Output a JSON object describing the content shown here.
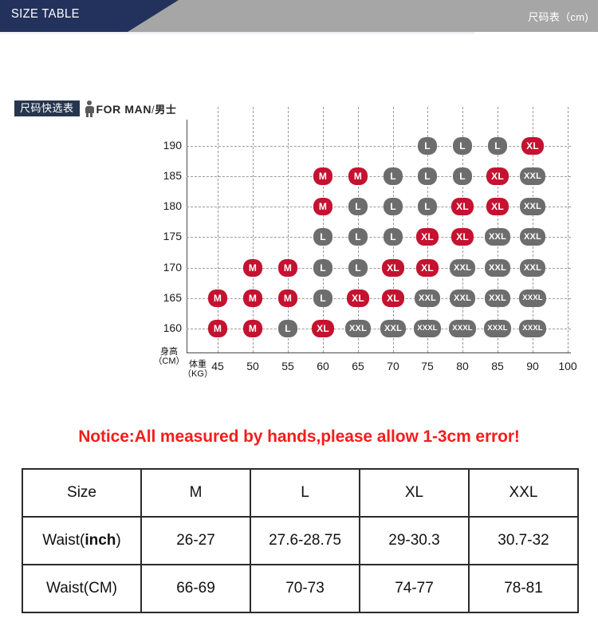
{
  "banner": {
    "title": "SIZE TABLE",
    "subtitle": "尺码表（cm)"
  },
  "section": {
    "chip_label": "尺码快选表",
    "icon": "person-icon",
    "for_label": "FOR MAN",
    "slash": "/",
    "cn_label": "男士"
  },
  "chart_data": {
    "type": "heatmap",
    "title": "",
    "xlabel": "体重（KG）",
    "ylabel": "身高（CM）",
    "x_axis_name_line1": "体重",
    "x_axis_name_line2": "（KG）",
    "y_axis_name_line1": "身高",
    "y_axis_name_line2": "（CM）",
    "categories": [
      45,
      50,
      55,
      60,
      65,
      70,
      75,
      80,
      85,
      90,
      100
    ],
    "y_ticks": [
      190,
      185,
      180,
      175,
      170,
      165,
      160
    ],
    "grid": "dashed",
    "legend": "none",
    "colors": {
      "size_red": "#c41230",
      "size_gray": "#6d6d6d",
      "gridline": "#9a9a9a",
      "axis": "#4a4a4a"
    },
    "cells": [
      {
        "height": 190,
        "weight": 75,
        "size": "L",
        "color": "gray"
      },
      {
        "height": 190,
        "weight": 80,
        "size": "L",
        "color": "gray"
      },
      {
        "height": 190,
        "weight": 85,
        "size": "L",
        "color": "gray"
      },
      {
        "height": 190,
        "weight": 90,
        "size": "XL",
        "color": "red"
      },
      {
        "height": 185,
        "weight": 60,
        "size": "M",
        "color": "red"
      },
      {
        "height": 185,
        "weight": 65,
        "size": "M",
        "color": "red"
      },
      {
        "height": 185,
        "weight": 70,
        "size": "L",
        "color": "gray"
      },
      {
        "height": 185,
        "weight": 75,
        "size": "L",
        "color": "gray"
      },
      {
        "height": 185,
        "weight": 80,
        "size": "L",
        "color": "gray"
      },
      {
        "height": 185,
        "weight": 85,
        "size": "XL",
        "color": "red"
      },
      {
        "height": 185,
        "weight": 90,
        "size": "XXL",
        "color": "gray"
      },
      {
        "height": 180,
        "weight": 60,
        "size": "M",
        "color": "red"
      },
      {
        "height": 180,
        "weight": 65,
        "size": "L",
        "color": "gray"
      },
      {
        "height": 180,
        "weight": 70,
        "size": "L",
        "color": "gray"
      },
      {
        "height": 180,
        "weight": 75,
        "size": "L",
        "color": "gray"
      },
      {
        "height": 180,
        "weight": 80,
        "size": "XL",
        "color": "red"
      },
      {
        "height": 180,
        "weight": 85,
        "size": "XL",
        "color": "red"
      },
      {
        "height": 180,
        "weight": 90,
        "size": "XXL",
        "color": "gray"
      },
      {
        "height": 175,
        "weight": 60,
        "size": "L",
        "color": "gray"
      },
      {
        "height": 175,
        "weight": 65,
        "size": "L",
        "color": "gray"
      },
      {
        "height": 175,
        "weight": 70,
        "size": "L",
        "color": "gray"
      },
      {
        "height": 175,
        "weight": 75,
        "size": "XL",
        "color": "red"
      },
      {
        "height": 175,
        "weight": 80,
        "size": "XL",
        "color": "red"
      },
      {
        "height": 175,
        "weight": 85,
        "size": "XXL",
        "color": "gray"
      },
      {
        "height": 175,
        "weight": 90,
        "size": "XXL",
        "color": "gray"
      },
      {
        "height": 170,
        "weight": 50,
        "size": "M",
        "color": "red"
      },
      {
        "height": 170,
        "weight": 55,
        "size": "M",
        "color": "red"
      },
      {
        "height": 170,
        "weight": 60,
        "size": "L",
        "color": "gray"
      },
      {
        "height": 170,
        "weight": 65,
        "size": "L",
        "color": "gray"
      },
      {
        "height": 170,
        "weight": 70,
        "size": "XL",
        "color": "red"
      },
      {
        "height": 170,
        "weight": 75,
        "size": "XL",
        "color": "red"
      },
      {
        "height": 170,
        "weight": 80,
        "size": "XXL",
        "color": "gray"
      },
      {
        "height": 170,
        "weight": 85,
        "size": "XXL",
        "color": "gray"
      },
      {
        "height": 170,
        "weight": 90,
        "size": "XXL",
        "color": "gray"
      },
      {
        "height": 165,
        "weight": 45,
        "size": "M",
        "color": "red"
      },
      {
        "height": 165,
        "weight": 50,
        "size": "M",
        "color": "red"
      },
      {
        "height": 165,
        "weight": 55,
        "size": "M",
        "color": "red"
      },
      {
        "height": 165,
        "weight": 60,
        "size": "L",
        "color": "gray"
      },
      {
        "height": 165,
        "weight": 65,
        "size": "XL",
        "color": "red"
      },
      {
        "height": 165,
        "weight": 70,
        "size": "XL",
        "color": "red"
      },
      {
        "height": 165,
        "weight": 75,
        "size": "XXL",
        "color": "gray"
      },
      {
        "height": 165,
        "weight": 80,
        "size": "XXL",
        "color": "gray"
      },
      {
        "height": 165,
        "weight": 85,
        "size": "XXL",
        "color": "gray"
      },
      {
        "height": 165,
        "weight": 90,
        "size": "XXXL",
        "color": "gray"
      },
      {
        "height": 160,
        "weight": 45,
        "size": "M",
        "color": "red"
      },
      {
        "height": 160,
        "weight": 50,
        "size": "M",
        "color": "red"
      },
      {
        "height": 160,
        "weight": 55,
        "size": "L",
        "color": "gray"
      },
      {
        "height": 160,
        "weight": 60,
        "size": "XL",
        "color": "red"
      },
      {
        "height": 160,
        "weight": 65,
        "size": "XXL",
        "color": "gray"
      },
      {
        "height": 160,
        "weight": 70,
        "size": "XXL",
        "color": "gray"
      },
      {
        "height": 160,
        "weight": 75,
        "size": "XXXL",
        "color": "gray"
      },
      {
        "height": 160,
        "weight": 80,
        "size": "XXXL",
        "color": "gray"
      },
      {
        "height": 160,
        "weight": 85,
        "size": "XXXL",
        "color": "gray"
      },
      {
        "height": 160,
        "weight": 90,
        "size": "XXXL",
        "color": "gray"
      }
    ]
  },
  "notice": "Notice:All measured by hands,please allow 1-3cm error!",
  "size_table": {
    "columns": [
      "Size",
      "M",
      "L",
      "XL",
      "XXL"
    ],
    "rows": [
      {
        "label_prefix": "Waist(",
        "label_bold": "inch",
        "label_suffix": ")",
        "values": [
          "26-27",
          "27.6-28.75",
          "29-30.3",
          "30.7-32"
        ]
      },
      {
        "label_prefix": "Waist(CM)",
        "label_bold": "",
        "label_suffix": "",
        "values": [
          "66-69",
          "70-73",
          "74-77",
          "78-81"
        ]
      }
    ]
  }
}
